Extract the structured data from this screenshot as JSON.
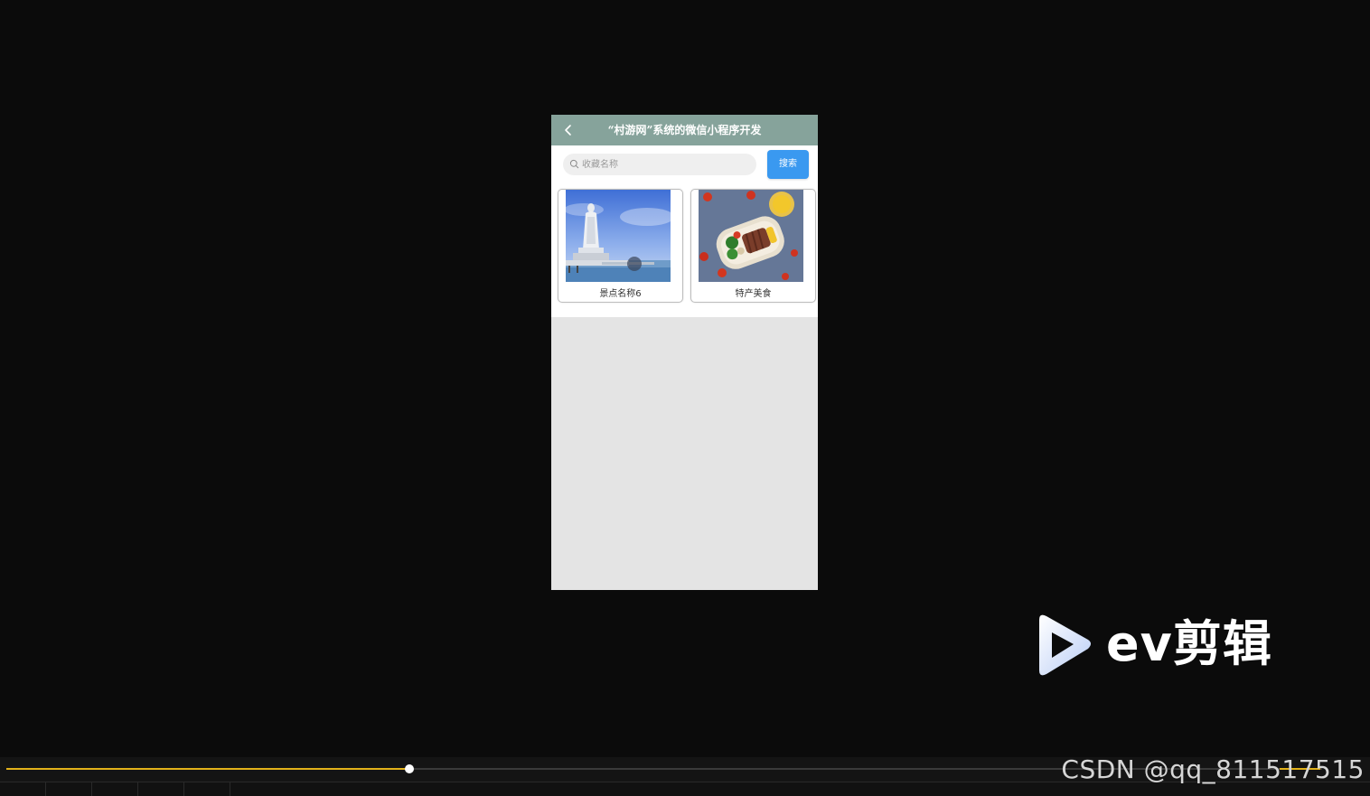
{
  "miniprogram": {
    "title": "“村游网”系统的微信小程序开发",
    "back_icon": "chevron-left-icon",
    "search": {
      "placeholder": "收藏名称",
      "value": "",
      "icon": "search-icon",
      "button_label": "搜索"
    },
    "favorites": [
      {
        "label": "景点名称6",
        "image": "guanyin-statue-seaside-photo"
      },
      {
        "label": "特产美食",
        "image": "steak-salad-bento-photo"
      }
    ]
  },
  "player": {
    "progress": 0.306,
    "logo_text": "ev剪辑",
    "logo_icon": "play-triangle-icon",
    "watermark": "CSDN @qq_811517515"
  },
  "colors": {
    "nav_bar": "#86a39b",
    "search_button": "#3a99f0",
    "progress": "#e2b21a",
    "page_bg": "#0b0b0b"
  }
}
